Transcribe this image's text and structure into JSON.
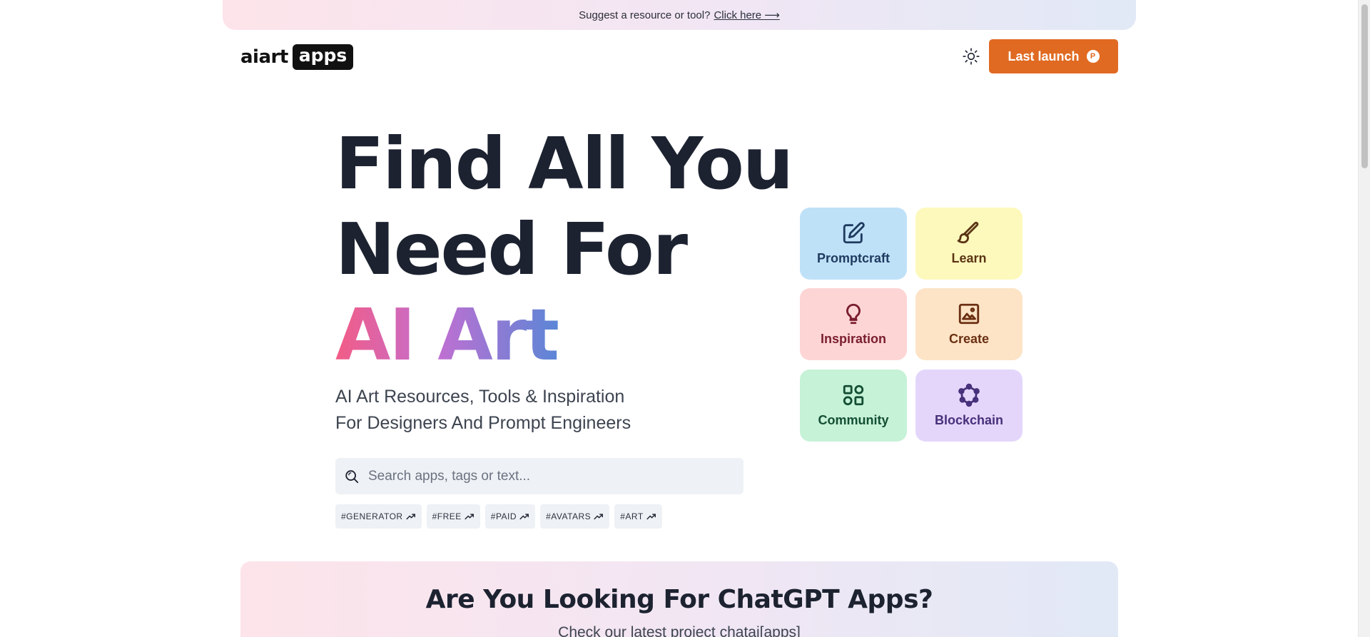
{
  "banner": {
    "text": "Suggest a resource or tool?",
    "link": "Click here ⟶"
  },
  "logo": {
    "part1": "aiart",
    "part2": "apps"
  },
  "header": {
    "launch_label": "Last launch",
    "launch_badge": "P",
    "theme_icon": "sun-icon"
  },
  "hero": {
    "line1": "Find All You",
    "line2": "Need For",
    "line3": "AI Art",
    "subtitle_line1": "AI Art Resources, Tools & Inspiration",
    "subtitle_line2": "For Designers And Prompt Engineers"
  },
  "search": {
    "placeholder": "Search apps, tags or text...",
    "value": ""
  },
  "tags": [
    "#GENERATOR",
    "#FREE",
    "#PAID",
    "#AVATARS",
    "#ART"
  ],
  "categories": [
    {
      "label": "Promptcraft",
      "icon": "edit-icon",
      "bg": "#bfe1f8",
      "fg": "#1e3a5f"
    },
    {
      "label": "Learn",
      "icon": "brush-icon",
      "bg": "#fdf9bd",
      "fg": "#5b3414"
    },
    {
      "label": "Inspiration",
      "icon": "lightbulb-icon",
      "bg": "#fdd5d5",
      "fg": "#7a1d2e"
    },
    {
      "label": "Create",
      "icon": "image-icon",
      "bg": "#fde4c6",
      "fg": "#6b2f12"
    },
    {
      "label": "Community",
      "icon": "grid-icon",
      "bg": "#c6f2d7",
      "fg": "#134e34"
    },
    {
      "label": "Blockchain",
      "icon": "network-icon",
      "bg": "#e4d6fb",
      "fg": "#46307a"
    }
  ],
  "promo": {
    "title": "Are You Looking For ChatGPT Apps?",
    "subtitle": "Check our latest project chatai[apps]"
  }
}
